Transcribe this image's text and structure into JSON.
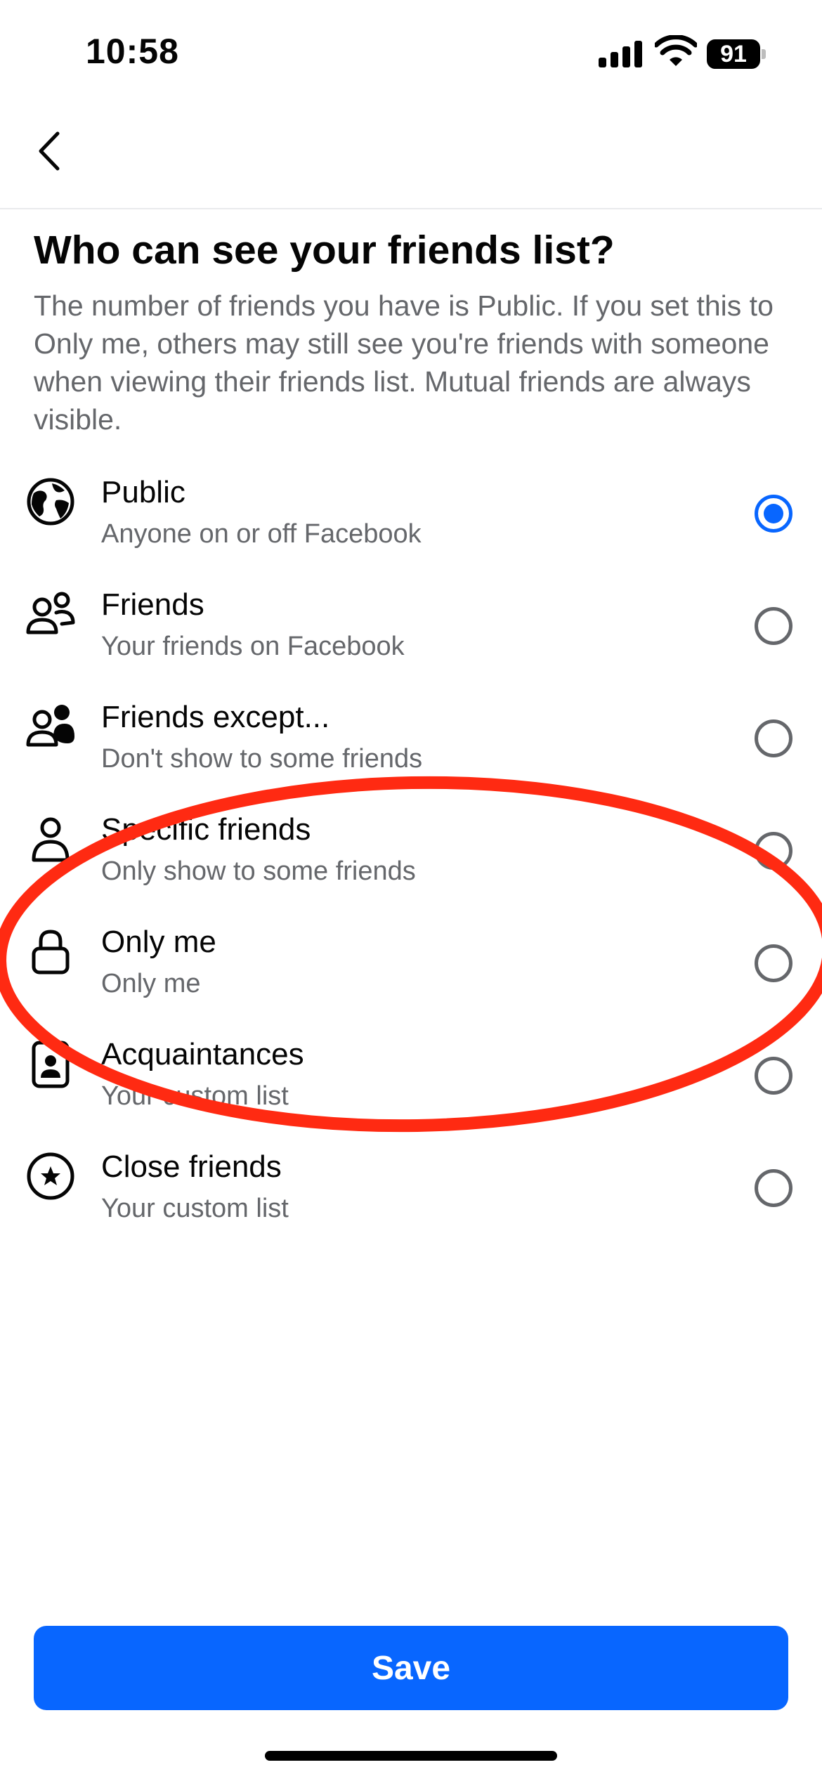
{
  "status_bar": {
    "time": "10:58",
    "battery": "91"
  },
  "nav": {
    "back_icon": "chevron-left-icon"
  },
  "header": {
    "title": "Who can see your friends list?",
    "description": "The number of friends you have is Public. If you set this to Only me, others may still see you're friends with someone when viewing their friends list. Mutual friends are always visible."
  },
  "options": [
    {
      "label": "Public",
      "sub": "Anyone on or off Facebook",
      "icon": "globe-icon",
      "selected": true
    },
    {
      "label": "Friends",
      "sub": "Your friends on Facebook",
      "icon": "friends-icon",
      "selected": false
    },
    {
      "label": "Friends except...",
      "sub": "Don't show to some friends",
      "icon": "friends-except-icon",
      "selected": false
    },
    {
      "label": "Specific friends",
      "sub": "Only show to some friends",
      "icon": "person-icon",
      "selected": false
    },
    {
      "label": "Only me",
      "sub": "Only me",
      "icon": "lock-icon",
      "selected": false
    },
    {
      "label": "Acquaintances",
      "sub": "Your custom list",
      "icon": "badge-icon",
      "selected": false
    },
    {
      "label": "Close friends",
      "sub": "Your custom list",
      "icon": "star-circle-icon",
      "selected": false
    }
  ],
  "footer": {
    "save_label": "Save"
  },
  "colors": {
    "accent": "#0866ff",
    "annotation": "#ff2a12",
    "secondary_text": "#65676b"
  }
}
